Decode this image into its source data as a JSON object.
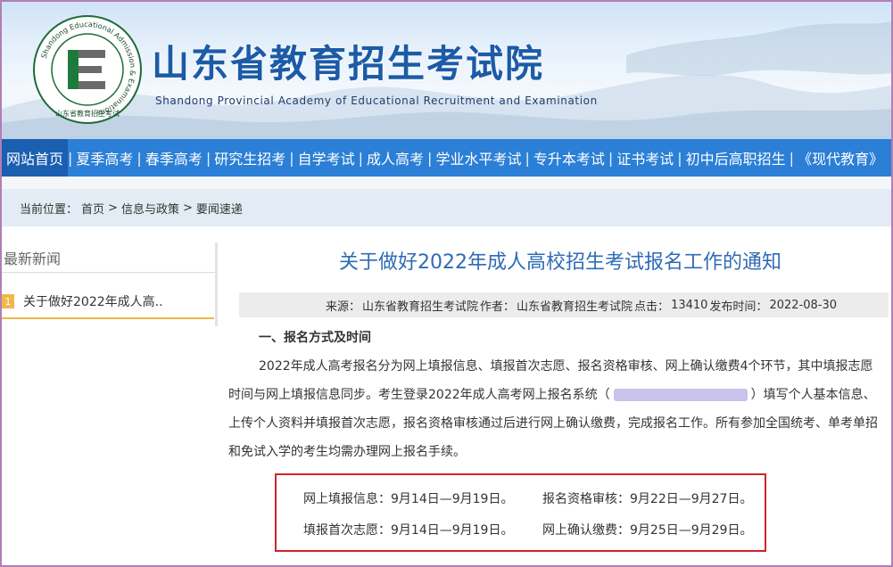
{
  "header": {
    "title": "山东省教育招生考试院",
    "subtitle": "Shandong Provincial Academy of Educational Recruitment and Examination",
    "logo": {
      "ring_text": "Shandong Educational Admission & Examinations",
      "bottom_text": "山东省教育招生考试",
      "letter": "E"
    }
  },
  "nav": {
    "items": [
      {
        "label": "网站首页"
      },
      {
        "label": "夏季高考"
      },
      {
        "label": "春季高考"
      },
      {
        "label": "研究生招考"
      },
      {
        "label": "自学考试"
      },
      {
        "label": "成人高考"
      },
      {
        "label": "学业水平考试"
      },
      {
        "label": "专升本考试"
      },
      {
        "label": "证书考试"
      },
      {
        "label": "初中后高职招生"
      },
      {
        "label": "《现代教育》"
      }
    ]
  },
  "breadcrumb": {
    "prefix": "当前位置：",
    "items": [
      "首页",
      "信息与政策",
      "要闻速递"
    ],
    "separator": ">"
  },
  "sidebar": {
    "heading": "最新新闻",
    "items": [
      {
        "index": "1",
        "label": "关于做好2022年成人高.."
      }
    ]
  },
  "article": {
    "title": "关于做好2022年成人高校招生考试报名工作的通知",
    "meta": {
      "source_label": "来源：",
      "source": "山东省教育招生考试院",
      "author_label": "作者：",
      "author": "山东省教育招生考试院",
      "clicks_label": "点击：",
      "clicks": "13410",
      "date_label": "发布时间：",
      "date": "2022-08-30"
    },
    "section_heading": "一、报名方式及时间",
    "para_part1": "2022年成人高考报名分为网上填报信息、填报首次志愿、报名资格审核、网上确认缴费4个环节，其中填报志愿时间与网上填报信息同步。考生登录2022年成人高考网上报名系统（",
    "para_part2": "）填写个人基本信息、上传个人资料并填报首次志愿，报名资格审核通过后进行网上确认缴费，完成报名工作。所有参加全国统考、单考单招和免试入学的考生均需办理网上报名手续。",
    "schedule": [
      {
        "label": "网上填报信息：",
        "value": "9月14日—9月19日。"
      },
      {
        "label": "报名资格审核：",
        "value": "9月22日—9月27日。"
      },
      {
        "label": "填报首次志愿：",
        "value": "9月14日—9月19日。"
      },
      {
        "label": "网上确认缴费：",
        "value": "9月25日—9月29日。"
      }
    ]
  },
  "colors": {
    "brand_blue": "#1c5ba6",
    "nav_blue": "#2b7fd6",
    "title_blue": "#2f6bb5",
    "highlight_red": "#d2232a",
    "accent_orange": "#f0b84a"
  }
}
